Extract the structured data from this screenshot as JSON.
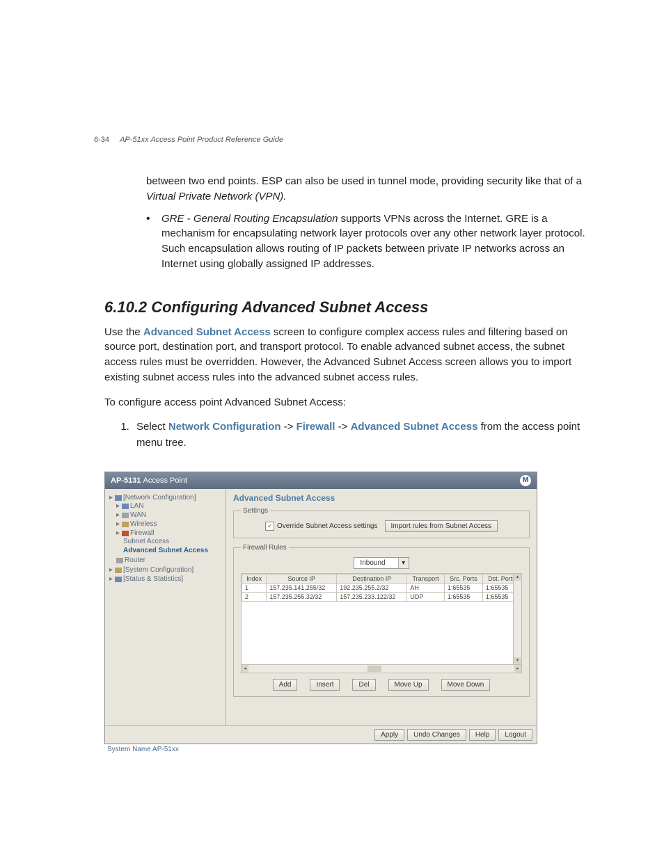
{
  "header": {
    "page_num": "6-34",
    "doc_title": "AP-51xx Access Point Product Reference Guide"
  },
  "para_esp": "between two end points. ESP can also be used in tunnel mode, providing security like that of a ",
  "para_esp_em": "Virtual Private Network (VPN).",
  "bullet_gre_term": "GRE",
  "bullet_gre_dash": " - ",
  "bullet_gre_em": "General Routing Encapsulation",
  "bullet_gre_rest": " supports VPNs across the Internet. GRE is a mechanism for encapsulating network layer protocols over any other network layer protocol. Such encapsulation allows routing of IP packets between private IP networks across an Internet using globally assigned IP addresses.",
  "section_heading": "6.10.2  Configuring Advanced Subnet Access",
  "intro_pre": "Use the ",
  "intro_link": "Advanced Subnet Access",
  "intro_post": " screen to configure complex access rules and filtering based on source port, destination port, and transport protocol. To enable advanced subnet access, the subnet access rules must be overridden. However, the Advanced Subnet Access screen allows you to import existing subnet access rules into the advanced subnet access rules.",
  "lead": "To configure access point Advanced Subnet Access:",
  "step1_pre": "Select ",
  "step1_a": "Network Configuration",
  "step1_sep": " -> ",
  "step1_b": "Firewall",
  "step1_c": "Advanced Subnet Access",
  "step1_post": " from the access point menu tree.",
  "app": {
    "title_prefix": "AP-5131 ",
    "title_rest": "Access Point",
    "logo": "M",
    "tree": {
      "net": "[Network Configuration]",
      "lan": "LAN",
      "wan": "WAN",
      "wireless": "Wireless",
      "firewall": "Firewall",
      "subnet": "Subnet Access",
      "adv": "Advanced Subnet Access",
      "router": "Router",
      "sys": "[System Configuration]",
      "stats": "[Status & Statistics]"
    },
    "panel_title": "Advanced Subnet Access",
    "settings_legend": "Settings",
    "override_label": "Override Subnet Access settings",
    "import_btn": "Import rules from Subnet Access",
    "rules_legend": "Firewall Rules",
    "direction": "Inbound",
    "columns": [
      "Index",
      "Source IP",
      "Destination IP",
      "Transport",
      "Src. Ports",
      "Dst. Ports"
    ],
    "rows": [
      {
        "idx": "1",
        "src": "157.235.141.255/32",
        "dst": "192.235.255.2/32",
        "tr": "AH",
        "sp": "1:65535",
        "dp": "1:65535"
      },
      {
        "idx": "2",
        "src": "157.235.255.32/32",
        "dst": "157.235.233.122/32",
        "tr": "UDP",
        "sp": "1:65535",
        "dp": "1:65535"
      }
    ],
    "btns": {
      "add": "Add",
      "insert": "Insert",
      "del": "Del",
      "up": "Move Up",
      "down": "Move Down",
      "apply": "Apply",
      "undo": "Undo Changes",
      "help": "Help",
      "logout": "Logout"
    },
    "status": "System Name AP-51xx"
  }
}
